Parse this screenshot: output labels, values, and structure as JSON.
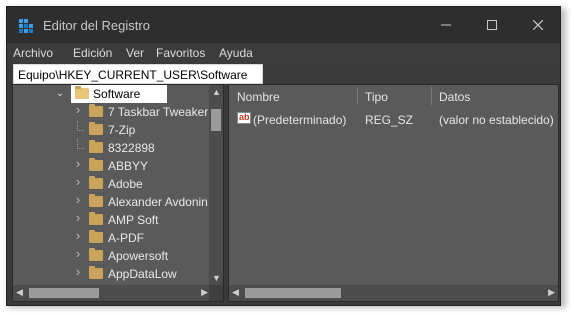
{
  "window": {
    "title": "Editor del Registro"
  },
  "controls": {
    "minimize": "—",
    "maximize": "☐",
    "close": "✕"
  },
  "menu": [
    "Archivo",
    "Edición",
    "Ver",
    "Favoritos",
    "Ayuda"
  ],
  "address": {
    "path": "Equipo\\HKEY_CURRENT_USER\\Software"
  },
  "tree": {
    "selected": "Software",
    "items": [
      {
        "label": "7 Taskbar Tweaker",
        "expandable": true
      },
      {
        "label": "7-Zip",
        "expandable": false
      },
      {
        "label": "8322898",
        "expandable": false
      },
      {
        "label": "ABBYY",
        "expandable": true
      },
      {
        "label": "Adobe",
        "expandable": true
      },
      {
        "label": "Alexander Avdonin",
        "expandable": true
      },
      {
        "label": "AMP Soft",
        "expandable": true
      },
      {
        "label": "A-PDF",
        "expandable": true
      },
      {
        "label": "Apowersoft",
        "expandable": true
      },
      {
        "label": "AppDataLow",
        "expandable": true
      }
    ]
  },
  "list": {
    "columns": [
      "Nombre",
      "Tipo",
      "Datos"
    ],
    "rows": [
      {
        "name": "(Predeterminado)",
        "type": "REG_SZ",
        "data": "(valor no establecido)"
      }
    ]
  },
  "colors": {
    "window_bg": "#3a3a3a",
    "pane_bg": "#5a5a5a",
    "folder": "#c9a35a",
    "selected": "#ffffff"
  }
}
